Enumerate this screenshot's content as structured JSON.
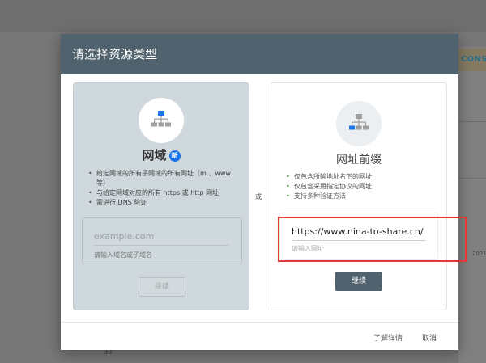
{
  "dialog": {
    "title": "请选择资源类型"
  },
  "background": {
    "tag": "CONSC",
    "year": "2021",
    "axis_value": "30"
  },
  "domain_card": {
    "title": "网域",
    "badge": "新",
    "icon": "sitemap-icon",
    "bullets": [
      "给定网域的所有子网域的所有网址（m.、www. 等）",
      "与给定网域对应的所有 https 或 http 网址",
      "需进行 DNS 验证"
    ],
    "input": {
      "placeholder": "example.com",
      "value": "",
      "hint": "请输入域名或子域名"
    },
    "continue_label": "继续"
  },
  "or_label": "或",
  "url_card": {
    "title": "网址前缀",
    "icon": "sitemap-icon",
    "bullets": [
      "仅包含所输地址名下的网址",
      "仅包含采用指定协议的网址",
      "支持多种验证方法"
    ],
    "input": {
      "placeholder": "",
      "value": "https://www.nina-to-share.cn/",
      "hint": "请输入网址"
    },
    "continue_label": "继续"
  },
  "footer": {
    "learn_more": "了解详情",
    "cancel": "取消"
  },
  "colors": {
    "header": "#4f626d",
    "accent": "#1a73e8",
    "highlight": "#e53935"
  }
}
